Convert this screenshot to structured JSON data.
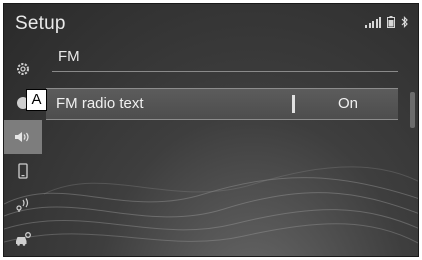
{
  "header": {
    "title": "Setup"
  },
  "status": {
    "signal_icon": "signal-bars-icon",
    "battery_icon": "battery-icon",
    "bluetooth_icon": "bluetooth-icon"
  },
  "sidebar": {
    "items": [
      {
        "icon": "gear-icon"
      },
      {
        "icon": "circle-icon"
      },
      {
        "icon": "speaker-icon",
        "active": true
      },
      {
        "icon": "phone-icon"
      },
      {
        "icon": "voice-icon"
      },
      {
        "icon": "car-settings-icon"
      }
    ]
  },
  "main": {
    "section_title": "FM",
    "rows": [
      {
        "label": "FM radio text",
        "value": "On"
      }
    ]
  },
  "annotation": {
    "callout": "A"
  }
}
